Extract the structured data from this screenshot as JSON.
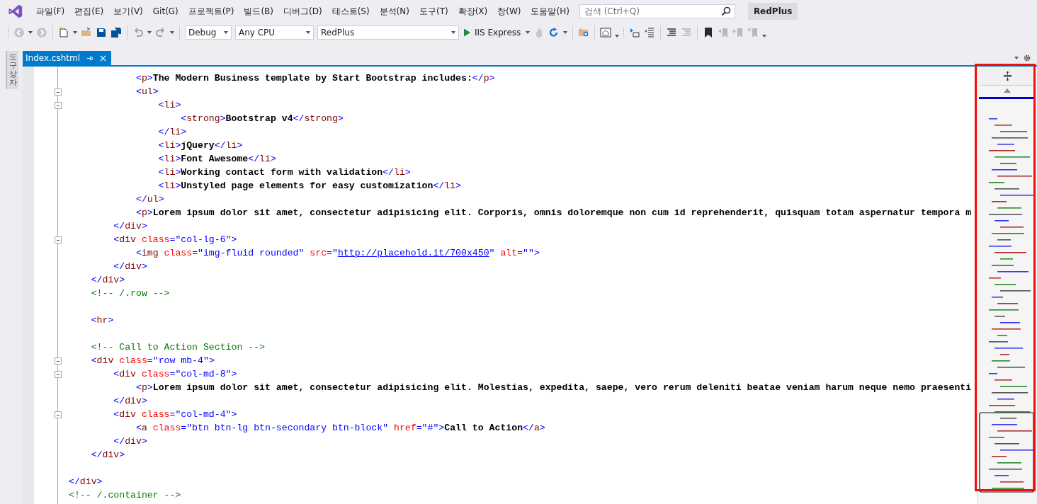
{
  "menu": [
    "파일(F)",
    "편집(E)",
    "보기(V)",
    "Git(G)",
    "프로젝트(P)",
    "빌드(B)",
    "디버그(D)",
    "테스트(S)",
    "분석(N)",
    "도구(T)",
    "확장(X)",
    "창(W)",
    "도움말(H)"
  ],
  "search": {
    "placeholder": "검색 (Ctrl+Q)"
  },
  "solution_name": "RedPlus",
  "toolbar": {
    "configuration": "Debug",
    "platform": "Any CPU",
    "startup_project": "RedPlus",
    "run_target": "IIS Express"
  },
  "side_tab": "도구 상자",
  "tabs": [
    {
      "label": "Index.cshtml",
      "selected": true
    }
  ],
  "code_lines": [
    {
      "foldable": false,
      "tokens": [
        {
          "kind": "d",
          "s": "            <"
        },
        {
          "kind": "tag",
          "s": "p"
        },
        {
          "kind": "d",
          "s": ">"
        },
        {
          "kind": "text",
          "s": "The Modern Business template by Start Bootstrap includes:"
        },
        {
          "kind": "d",
          "s": "</"
        },
        {
          "kind": "tag",
          "s": "p"
        },
        {
          "kind": "d",
          "s": ">"
        }
      ]
    },
    {
      "foldable": true,
      "tokens": [
        {
          "kind": "d",
          "s": "            <"
        },
        {
          "kind": "tag",
          "s": "ul"
        },
        {
          "kind": "d",
          "s": ">"
        }
      ]
    },
    {
      "foldable": true,
      "tokens": [
        {
          "kind": "d",
          "s": "                <"
        },
        {
          "kind": "tag",
          "s": "li"
        },
        {
          "kind": "d",
          "s": ">"
        }
      ]
    },
    {
      "foldable": false,
      "tokens": [
        {
          "kind": "d",
          "s": "                    <"
        },
        {
          "kind": "tag",
          "s": "strong"
        },
        {
          "kind": "d",
          "s": ">"
        },
        {
          "kind": "text",
          "s": "Bootstrap v4"
        },
        {
          "kind": "d",
          "s": "</"
        },
        {
          "kind": "tag",
          "s": "strong"
        },
        {
          "kind": "d",
          "s": ">"
        }
      ]
    },
    {
      "foldable": false,
      "tokens": [
        {
          "kind": "d",
          "s": "                </"
        },
        {
          "kind": "tag",
          "s": "li"
        },
        {
          "kind": "d",
          "s": ">"
        }
      ]
    },
    {
      "foldable": false,
      "tokens": [
        {
          "kind": "d",
          "s": "                <"
        },
        {
          "kind": "tag",
          "s": "li"
        },
        {
          "kind": "d",
          "s": ">"
        },
        {
          "kind": "text",
          "s": "jQuery"
        },
        {
          "kind": "d",
          "s": "</"
        },
        {
          "kind": "tag",
          "s": "li"
        },
        {
          "kind": "d",
          "s": ">"
        }
      ]
    },
    {
      "foldable": false,
      "tokens": [
        {
          "kind": "d",
          "s": "                <"
        },
        {
          "kind": "tag",
          "s": "li"
        },
        {
          "kind": "d",
          "s": ">"
        },
        {
          "kind": "text",
          "s": "Font Awesome"
        },
        {
          "kind": "d",
          "s": "</"
        },
        {
          "kind": "tag",
          "s": "li"
        },
        {
          "kind": "d",
          "s": ">"
        }
      ]
    },
    {
      "foldable": false,
      "tokens": [
        {
          "kind": "d",
          "s": "                <"
        },
        {
          "kind": "tag",
          "s": "li"
        },
        {
          "kind": "d",
          "s": ">"
        },
        {
          "kind": "text",
          "s": "Working contact form with validation"
        },
        {
          "kind": "d",
          "s": "</"
        },
        {
          "kind": "tag",
          "s": "li"
        },
        {
          "kind": "d",
          "s": ">"
        }
      ]
    },
    {
      "foldable": false,
      "tokens": [
        {
          "kind": "d",
          "s": "                <"
        },
        {
          "kind": "tag",
          "s": "li"
        },
        {
          "kind": "d",
          "s": ">"
        },
        {
          "kind": "text",
          "s": "Unstyled page elements for easy customization"
        },
        {
          "kind": "d",
          "s": "</"
        },
        {
          "kind": "tag",
          "s": "li"
        },
        {
          "kind": "d",
          "s": ">"
        }
      ]
    },
    {
      "foldable": false,
      "tokens": [
        {
          "kind": "d",
          "s": "            </"
        },
        {
          "kind": "tag",
          "s": "ul"
        },
        {
          "kind": "d",
          "s": ">"
        }
      ]
    },
    {
      "foldable": false,
      "tokens": [
        {
          "kind": "d",
          "s": "            <"
        },
        {
          "kind": "tag",
          "s": "p"
        },
        {
          "kind": "d",
          "s": ">"
        },
        {
          "kind": "text",
          "s": "Lorem ipsum dolor sit amet, consectetur adipisicing elit. Corporis, omnis doloremque non cum id reprehenderit, quisquam totam aspernatur tempora m"
        }
      ]
    },
    {
      "foldable": false,
      "tokens": [
        {
          "kind": "d",
          "s": "        </"
        },
        {
          "kind": "tag",
          "s": "div"
        },
        {
          "kind": "d",
          "s": ">"
        }
      ]
    },
    {
      "foldable": true,
      "tokens": [
        {
          "kind": "d",
          "s": "        <"
        },
        {
          "kind": "tag",
          "s": "div"
        },
        {
          "kind": "attr",
          "s": " class"
        },
        {
          "kind": "val",
          "s": "=\"col-lg-6\""
        },
        {
          "kind": "d",
          "s": ">"
        }
      ]
    },
    {
      "foldable": false,
      "tokens": [
        {
          "kind": "d",
          "s": "            <"
        },
        {
          "kind": "tag",
          "s": "img"
        },
        {
          "kind": "attr",
          "s": " class"
        },
        {
          "kind": "val",
          "s": "=\"img-fluid rounded\""
        },
        {
          "kind": "attr",
          "s": " src"
        },
        {
          "kind": "val",
          "s": "=\""
        },
        {
          "kind": "link",
          "s": "http://placehold.it/700x450"
        },
        {
          "kind": "val",
          "s": "\""
        },
        {
          "kind": "attr",
          "s": " alt"
        },
        {
          "kind": "val",
          "s": "=\"\""
        },
        {
          "kind": "d",
          "s": ">"
        }
      ]
    },
    {
      "foldable": false,
      "tokens": [
        {
          "kind": "d",
          "s": "        </"
        },
        {
          "kind": "tag",
          "s": "div"
        },
        {
          "kind": "d",
          "s": ">"
        }
      ]
    },
    {
      "foldable": false,
      "tokens": [
        {
          "kind": "d",
          "s": "    </"
        },
        {
          "kind": "tag",
          "s": "div"
        },
        {
          "kind": "d",
          "s": ">"
        }
      ]
    },
    {
      "foldable": false,
      "tokens": [
        {
          "kind": "comment",
          "s": "    <!-- /.row -->"
        }
      ]
    },
    {
      "foldable": false
    },
    {
      "foldable": false,
      "tokens": [
        {
          "kind": "d",
          "s": "    <"
        },
        {
          "kind": "tag",
          "s": "hr"
        },
        {
          "kind": "d",
          "s": ">"
        }
      ]
    },
    {
      "foldable": false
    },
    {
      "foldable": false,
      "tokens": [
        {
          "kind": "comment",
          "s": "    <!-- Call to Action Section -->"
        }
      ]
    },
    {
      "foldable": true,
      "tokens": [
        {
          "kind": "d",
          "s": "    <"
        },
        {
          "kind": "tag",
          "s": "div"
        },
        {
          "kind": "attr",
          "s": " class"
        },
        {
          "kind": "val",
          "s": "=\"row mb-4\""
        },
        {
          "kind": "d",
          "s": ">"
        }
      ]
    },
    {
      "foldable": true,
      "tokens": [
        {
          "kind": "d",
          "s": "        <"
        },
        {
          "kind": "tag",
          "s": "div"
        },
        {
          "kind": "attr",
          "s": " class"
        },
        {
          "kind": "val",
          "s": "=\"col-md-8\""
        },
        {
          "kind": "d",
          "s": ">"
        }
      ]
    },
    {
      "foldable": false,
      "tokens": [
        {
          "kind": "d",
          "s": "            <"
        },
        {
          "kind": "tag",
          "s": "p"
        },
        {
          "kind": "d",
          "s": ">"
        },
        {
          "kind": "text",
          "s": "Lorem ipsum dolor sit amet, consectetur adipisicing elit. Molestias, expedita, saepe, vero rerum deleniti beatae veniam harum neque nemo praesenti"
        }
      ]
    },
    {
      "foldable": false,
      "tokens": [
        {
          "kind": "d",
          "s": "        </"
        },
        {
          "kind": "tag",
          "s": "div"
        },
        {
          "kind": "d",
          "s": ">"
        }
      ]
    },
    {
      "foldable": true,
      "tokens": [
        {
          "kind": "d",
          "s": "        <"
        },
        {
          "kind": "tag",
          "s": "div"
        },
        {
          "kind": "attr",
          "s": " class"
        },
        {
          "kind": "val",
          "s": "=\"col-md-4\""
        },
        {
          "kind": "d",
          "s": ">"
        }
      ]
    },
    {
      "foldable": false,
      "tokens": [
        {
          "kind": "d",
          "s": "            <"
        },
        {
          "kind": "tag",
          "s": "a"
        },
        {
          "kind": "attr",
          "s": " class"
        },
        {
          "kind": "val",
          "s": "=\"btn btn-lg btn-secondary btn-block\""
        },
        {
          "kind": "attr",
          "s": " href"
        },
        {
          "kind": "val",
          "s": "=\"#\""
        },
        {
          "kind": "d",
          "s": ">"
        },
        {
          "kind": "text",
          "s": "Call to Action"
        },
        {
          "kind": "d",
          "s": "</"
        },
        {
          "kind": "tag",
          "s": "a"
        },
        {
          "kind": "d",
          "s": ">"
        }
      ]
    },
    {
      "foldable": false,
      "tokens": [
        {
          "kind": "d",
          "s": "        </"
        },
        {
          "kind": "tag",
          "s": "div"
        },
        {
          "kind": "d",
          "s": ">"
        }
      ]
    },
    {
      "foldable": false,
      "tokens": [
        {
          "kind": "d",
          "s": "    </"
        },
        {
          "kind": "tag",
          "s": "div"
        },
        {
          "kind": "d",
          "s": ">"
        }
      ]
    },
    {
      "foldable": false
    },
    {
      "foldable": false,
      "tokens": [
        {
          "kind": "d",
          "s": "</"
        },
        {
          "kind": "tag",
          "s": "div"
        },
        {
          "kind": "d",
          "s": ">"
        }
      ]
    },
    {
      "foldable": false,
      "tokens": [
        {
          "kind": "comment",
          "s": "<!-- /.container -->"
        }
      ]
    }
  ]
}
